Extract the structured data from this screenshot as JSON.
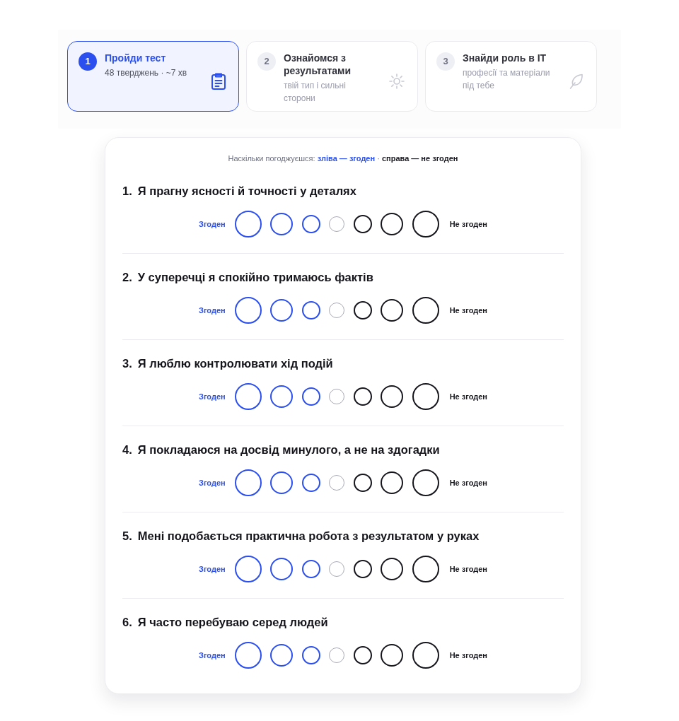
{
  "steps": [
    {
      "number": "1",
      "title": "Пройди тест",
      "subtitle": "48 тверджень · ~7 хв",
      "selected": true
    },
    {
      "number": "2",
      "title": "Ознайомся з результатами",
      "subtitle": "твій тип і сильні сторони",
      "selected": false
    },
    {
      "number": "3",
      "title": "Знайди роль в IT",
      "subtitle": "професії та матеріали під тебе",
      "selected": false
    }
  ],
  "legend": {
    "prefix": "Наскільки погоджуєшся:",
    "left": "зліва — згоден",
    "separator": "·",
    "right": "справа — не згоден"
  },
  "questions": [
    {
      "number": "1.",
      "text": "Я прагну ясності й точності у деталях",
      "agree_label": "Згоден",
      "disagree_label": "Не згоден",
      "options": [
        {
          "kind": "agree",
          "selected": false
        },
        {
          "kind": "agree",
          "selected": false
        },
        {
          "kind": "agree",
          "selected": false
        },
        {
          "kind": "neutral",
          "selected": false
        },
        {
          "kind": "disagree",
          "selected": false
        },
        {
          "kind": "disagree",
          "selected": false
        },
        {
          "kind": "disagree",
          "selected": false
        }
      ]
    },
    {
      "number": "2.",
      "text": "У суперечці я спокійно тримаюсь фактів",
      "agree_label": "Згоден",
      "disagree_label": "Не згоден",
      "options": [
        {
          "kind": "agree",
          "selected": false
        },
        {
          "kind": "agree",
          "selected": false
        },
        {
          "kind": "agree",
          "selected": false
        },
        {
          "kind": "neutral",
          "selected": false
        },
        {
          "kind": "disagree",
          "selected": false
        },
        {
          "kind": "disagree",
          "selected": false
        },
        {
          "kind": "disagree",
          "selected": false
        }
      ]
    },
    {
      "number": "3.",
      "text": "Я люблю контролювати хід подій",
      "agree_label": "Згоден",
      "disagree_label": "Не згоден",
      "options": [
        {
          "kind": "agree",
          "selected": false
        },
        {
          "kind": "agree",
          "selected": false
        },
        {
          "kind": "agree",
          "selected": false
        },
        {
          "kind": "neutral",
          "selected": false
        },
        {
          "kind": "disagree",
          "selected": false
        },
        {
          "kind": "disagree",
          "selected": false
        },
        {
          "kind": "disagree",
          "selected": false
        }
      ]
    },
    {
      "number": "4.",
      "text": "Я покладаюся на досвід минулого, а не на здогадки",
      "agree_label": "Згоден",
      "disagree_label": "Не згоден",
      "options": [
        {
          "kind": "agree",
          "selected": false
        },
        {
          "kind": "agree",
          "selected": false
        },
        {
          "kind": "agree",
          "selected": false
        },
        {
          "kind": "neutral",
          "selected": false
        },
        {
          "kind": "disagree",
          "selected": false
        },
        {
          "kind": "disagree",
          "selected": false
        },
        {
          "kind": "disagree",
          "selected": false
        }
      ]
    },
    {
      "number": "5.",
      "text": "Мені подобається практична робота з результатом у руках",
      "agree_label": "Згоден",
      "disagree_label": "Не згоден",
      "options": [
        {
          "kind": "agree",
          "selected": false
        },
        {
          "kind": "agree",
          "selected": false
        },
        {
          "kind": "agree",
          "selected": false
        },
        {
          "kind": "neutral",
          "selected": false
        },
        {
          "kind": "disagree",
          "selected": false
        },
        {
          "kind": "disagree",
          "selected": false
        },
        {
          "kind": "disagree",
          "selected": false
        }
      ]
    },
    {
      "number": "6.",
      "text": "Я часто перебуваю серед людей",
      "agree_label": "Згоден",
      "disagree_label": "Не згоден",
      "options": [
        {
          "kind": "agree",
          "selected": false
        },
        {
          "kind": "agree",
          "selected": false
        },
        {
          "kind": "agree",
          "selected": false
        },
        {
          "kind": "neutral",
          "selected": false
        },
        {
          "kind": "disagree",
          "selected": false
        },
        {
          "kind": "disagree",
          "selected": false
        },
        {
          "kind": "disagree",
          "selected": false
        }
      ]
    }
  ]
}
